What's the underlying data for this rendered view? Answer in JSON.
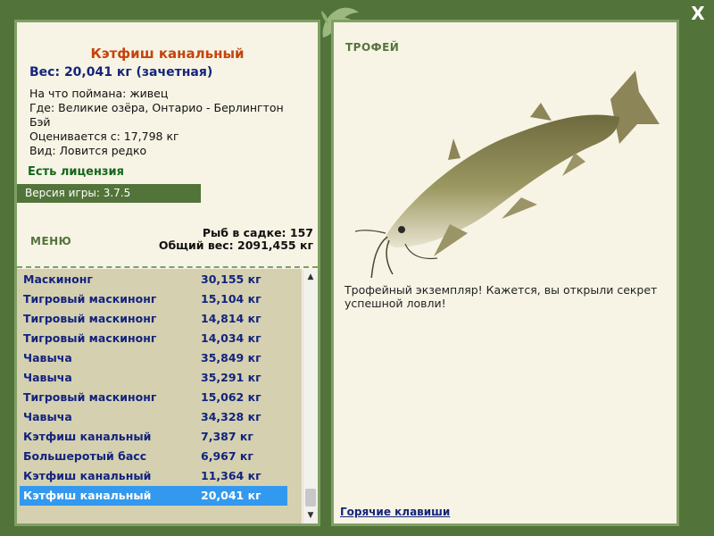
{
  "window": {
    "close_label": "X"
  },
  "fish": {
    "title": "Кэтфиш канальный",
    "weight": "Вес: 20,041 кг (зачетная)",
    "details": [
      "На что поймана: живец",
      "Где: Великие озёра, Онтарио - Берлингтон Бэй",
      "Оценивается с: 17,798 кг",
      "Вид: Ловится редко"
    ],
    "license": "Есть лицензия"
  },
  "version": "Версия игры: 3.7.5",
  "menu_label": "МЕНЮ",
  "stats": {
    "fish_count": "Рыб в садке: 157",
    "total_weight": "Общий вес: 2091,455 кг"
  },
  "catch_list": [
    {
      "name": "Маскинонг",
      "weight": "30,155 кг"
    },
    {
      "name": "Тигровый маскинонг",
      "weight": "15,104 кг"
    },
    {
      "name": "Тигровый маскинонг",
      "weight": "14,814 кг"
    },
    {
      "name": "Тигровый маскинонг",
      "weight": "14,034 кг"
    },
    {
      "name": "Чавыча",
      "weight": "35,849 кг"
    },
    {
      "name": "Чавыча",
      "weight": "35,291 кг"
    },
    {
      "name": "Тигровый маскинонг",
      "weight": "15,062 кг"
    },
    {
      "name": "Чавыча",
      "weight": "34,328 кг"
    },
    {
      "name": "Кэтфиш канальный",
      "weight": "7,387 кг"
    },
    {
      "name": "Большеротый басс",
      "weight": "6,967 кг"
    },
    {
      "name": "Кэтфиш канальный",
      "weight": "11,364 кг"
    },
    {
      "name": "Кэтфиш канальный",
      "weight": "20,041 кг"
    }
  ],
  "selected_index": 11,
  "scrollbar": {
    "up_icon": "▲",
    "down_icon": "▼"
  },
  "trophy": {
    "label": "ТРОФЕЙ",
    "text": "Трофейный экземпляр! Кажется, вы открыли секрет успешной ловли!"
  },
  "hotkeys_label": "Горячие клавиши",
  "colors": {
    "frame_green": "#52743a",
    "panel_bg": "#f7f4e5",
    "title_orange": "#c5440c",
    "list_text_blue": "#13237e",
    "selection_blue": "#3399ee"
  }
}
